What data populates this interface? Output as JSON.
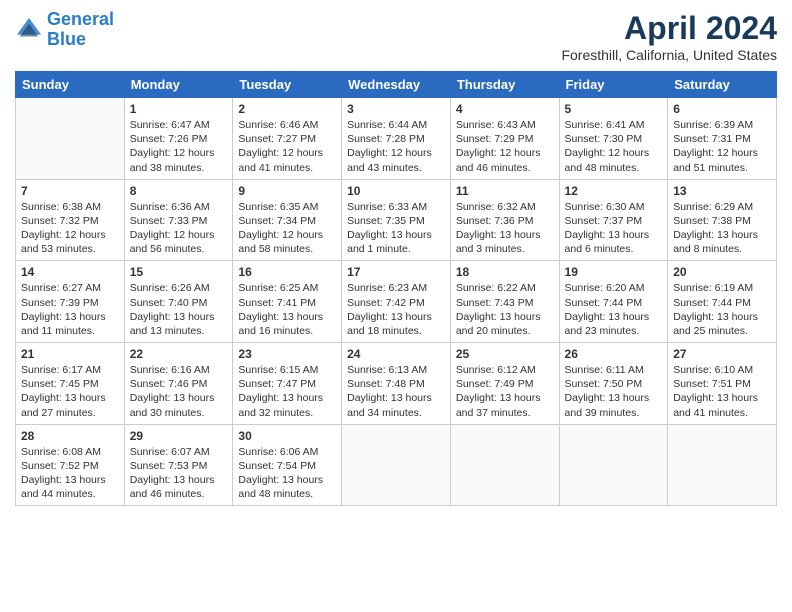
{
  "header": {
    "logo_line1": "General",
    "logo_line2": "Blue",
    "title": "April 2024",
    "subtitle": "Foresthill, California, United States"
  },
  "days_of_week": [
    "Sunday",
    "Monday",
    "Tuesday",
    "Wednesday",
    "Thursday",
    "Friday",
    "Saturday"
  ],
  "weeks": [
    [
      {
        "day": null,
        "info": null
      },
      {
        "day": "1",
        "info": "Sunrise: 6:47 AM\nSunset: 7:26 PM\nDaylight: 12 hours\nand 38 minutes."
      },
      {
        "day": "2",
        "info": "Sunrise: 6:46 AM\nSunset: 7:27 PM\nDaylight: 12 hours\nand 41 minutes."
      },
      {
        "day": "3",
        "info": "Sunrise: 6:44 AM\nSunset: 7:28 PM\nDaylight: 12 hours\nand 43 minutes."
      },
      {
        "day": "4",
        "info": "Sunrise: 6:43 AM\nSunset: 7:29 PM\nDaylight: 12 hours\nand 46 minutes."
      },
      {
        "day": "5",
        "info": "Sunrise: 6:41 AM\nSunset: 7:30 PM\nDaylight: 12 hours\nand 48 minutes."
      },
      {
        "day": "6",
        "info": "Sunrise: 6:39 AM\nSunset: 7:31 PM\nDaylight: 12 hours\nand 51 minutes."
      }
    ],
    [
      {
        "day": "7",
        "info": "Sunrise: 6:38 AM\nSunset: 7:32 PM\nDaylight: 12 hours\nand 53 minutes."
      },
      {
        "day": "8",
        "info": "Sunrise: 6:36 AM\nSunset: 7:33 PM\nDaylight: 12 hours\nand 56 minutes."
      },
      {
        "day": "9",
        "info": "Sunrise: 6:35 AM\nSunset: 7:34 PM\nDaylight: 12 hours\nand 58 minutes."
      },
      {
        "day": "10",
        "info": "Sunrise: 6:33 AM\nSunset: 7:35 PM\nDaylight: 13 hours\nand 1 minute."
      },
      {
        "day": "11",
        "info": "Sunrise: 6:32 AM\nSunset: 7:36 PM\nDaylight: 13 hours\nand 3 minutes."
      },
      {
        "day": "12",
        "info": "Sunrise: 6:30 AM\nSunset: 7:37 PM\nDaylight: 13 hours\nand 6 minutes."
      },
      {
        "day": "13",
        "info": "Sunrise: 6:29 AM\nSunset: 7:38 PM\nDaylight: 13 hours\nand 8 minutes."
      }
    ],
    [
      {
        "day": "14",
        "info": "Sunrise: 6:27 AM\nSunset: 7:39 PM\nDaylight: 13 hours\nand 11 minutes."
      },
      {
        "day": "15",
        "info": "Sunrise: 6:26 AM\nSunset: 7:40 PM\nDaylight: 13 hours\nand 13 minutes."
      },
      {
        "day": "16",
        "info": "Sunrise: 6:25 AM\nSunset: 7:41 PM\nDaylight: 13 hours\nand 16 minutes."
      },
      {
        "day": "17",
        "info": "Sunrise: 6:23 AM\nSunset: 7:42 PM\nDaylight: 13 hours\nand 18 minutes."
      },
      {
        "day": "18",
        "info": "Sunrise: 6:22 AM\nSunset: 7:43 PM\nDaylight: 13 hours\nand 20 minutes."
      },
      {
        "day": "19",
        "info": "Sunrise: 6:20 AM\nSunset: 7:44 PM\nDaylight: 13 hours\nand 23 minutes."
      },
      {
        "day": "20",
        "info": "Sunrise: 6:19 AM\nSunset: 7:44 PM\nDaylight: 13 hours\nand 25 minutes."
      }
    ],
    [
      {
        "day": "21",
        "info": "Sunrise: 6:17 AM\nSunset: 7:45 PM\nDaylight: 13 hours\nand 27 minutes."
      },
      {
        "day": "22",
        "info": "Sunrise: 6:16 AM\nSunset: 7:46 PM\nDaylight: 13 hours\nand 30 minutes."
      },
      {
        "day": "23",
        "info": "Sunrise: 6:15 AM\nSunset: 7:47 PM\nDaylight: 13 hours\nand 32 minutes."
      },
      {
        "day": "24",
        "info": "Sunrise: 6:13 AM\nSunset: 7:48 PM\nDaylight: 13 hours\nand 34 minutes."
      },
      {
        "day": "25",
        "info": "Sunrise: 6:12 AM\nSunset: 7:49 PM\nDaylight: 13 hours\nand 37 minutes."
      },
      {
        "day": "26",
        "info": "Sunrise: 6:11 AM\nSunset: 7:50 PM\nDaylight: 13 hours\nand 39 minutes."
      },
      {
        "day": "27",
        "info": "Sunrise: 6:10 AM\nSunset: 7:51 PM\nDaylight: 13 hours\nand 41 minutes."
      }
    ],
    [
      {
        "day": "28",
        "info": "Sunrise: 6:08 AM\nSunset: 7:52 PM\nDaylight: 13 hours\nand 44 minutes."
      },
      {
        "day": "29",
        "info": "Sunrise: 6:07 AM\nSunset: 7:53 PM\nDaylight: 13 hours\nand 46 minutes."
      },
      {
        "day": "30",
        "info": "Sunrise: 6:06 AM\nSunset: 7:54 PM\nDaylight: 13 hours\nand 48 minutes."
      },
      {
        "day": null,
        "info": null
      },
      {
        "day": null,
        "info": null
      },
      {
        "day": null,
        "info": null
      },
      {
        "day": null,
        "info": null
      }
    ]
  ]
}
